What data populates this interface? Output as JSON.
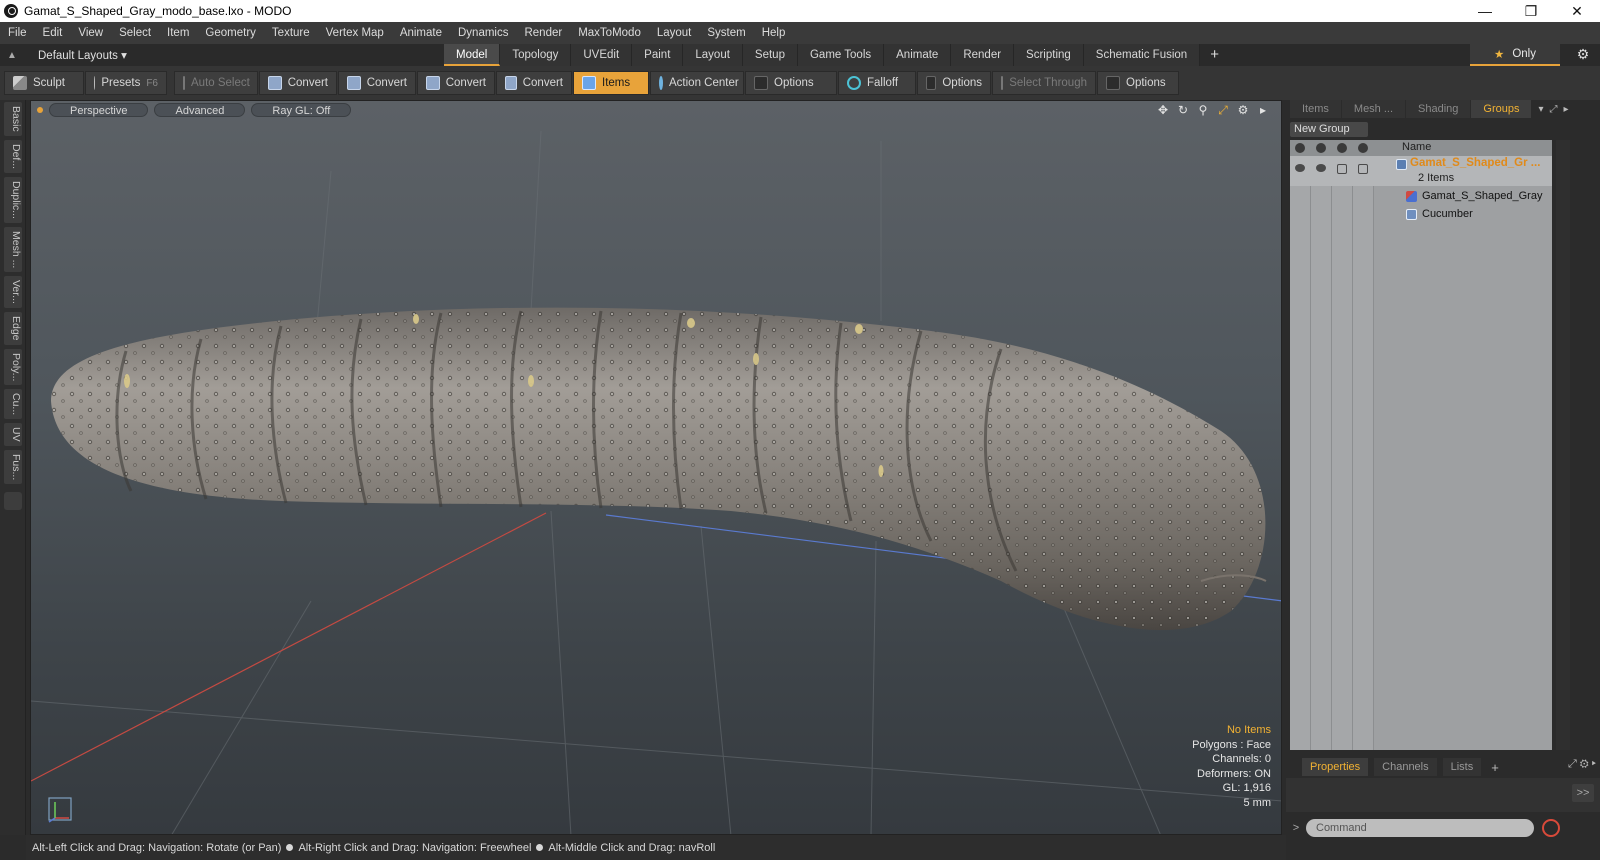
{
  "window": {
    "title": "Gamat_S_Shaped_Gray_modo_base.lxo - MODO",
    "controls": [
      "minimize",
      "maximize",
      "close"
    ]
  },
  "menu": [
    "File",
    "Edit",
    "View",
    "Select",
    "Item",
    "Geometry",
    "Texture",
    "Vertex Map",
    "Animate",
    "Dynamics",
    "Render",
    "MaxToModo",
    "Layout",
    "System",
    "Help"
  ],
  "layout": {
    "selector": "Default Layouts",
    "tabs": [
      "Model",
      "Topology",
      "UVEdit",
      "Paint",
      "Layout",
      "Setup",
      "Game Tools",
      "Animate",
      "Render",
      "Scripting",
      "Schematic Fusion"
    ],
    "active_tab": "Model",
    "only_label": "Only"
  },
  "toolbar": {
    "sculpt": "Sculpt",
    "presets": "Presets",
    "presets_key": "F6",
    "auto_select": "Auto Select",
    "convert1": "Convert",
    "convert2": "Convert",
    "convert3": "Convert",
    "convert4": "Convert",
    "items": "Items",
    "action_center": "Action Center",
    "options1": "Options",
    "falloff": "Falloff",
    "options2": "Options",
    "select_through": "Select Through",
    "options3": "Options"
  },
  "left_tabs": [
    "Basic",
    "Def...",
    "Duplic...",
    "Mesh ...",
    "Ver...",
    "Edge",
    "Poly...",
    "Cu...",
    "UV",
    "Fus..."
  ],
  "viewport": {
    "view_mode": "Perspective",
    "shading": "Advanced",
    "raygl": "Ray GL: Off",
    "info": {
      "no_items": "No Items",
      "polygons": "Polygons : Face",
      "channels": "Channels: 0",
      "deformers": "Deformers: ON",
      "gl": "GL: 1,916",
      "scale": "5 mm"
    }
  },
  "status": {
    "hint1": "Alt-Left Click and Drag: Navigation: Rotate (or Pan)",
    "hint2": "Alt-Right Click and Drag: Navigation: Freewheel",
    "hint3": "Alt-Middle Click and Drag: navRoll"
  },
  "right_panel": {
    "tabs": [
      "Items",
      "Mesh ...",
      "Shading",
      "Groups"
    ],
    "active_tab": "Groups",
    "new_group": "New Group",
    "column_name": "Name",
    "group": {
      "name": "Gamat_S_Shaped_Gr ...",
      "count": "2 Items",
      "children": [
        "Gamat_S_Shaped_Gray",
        "Cucumber"
      ]
    },
    "bottom_tabs": [
      "Properties",
      "Channels",
      "Lists"
    ],
    "bottom_active": "Properties",
    "expand": ">>",
    "command_placeholder": "Command"
  },
  "colors": {
    "accent": "#e8a33a",
    "group_name": "#e08a1a",
    "record": "#d84a3a"
  }
}
